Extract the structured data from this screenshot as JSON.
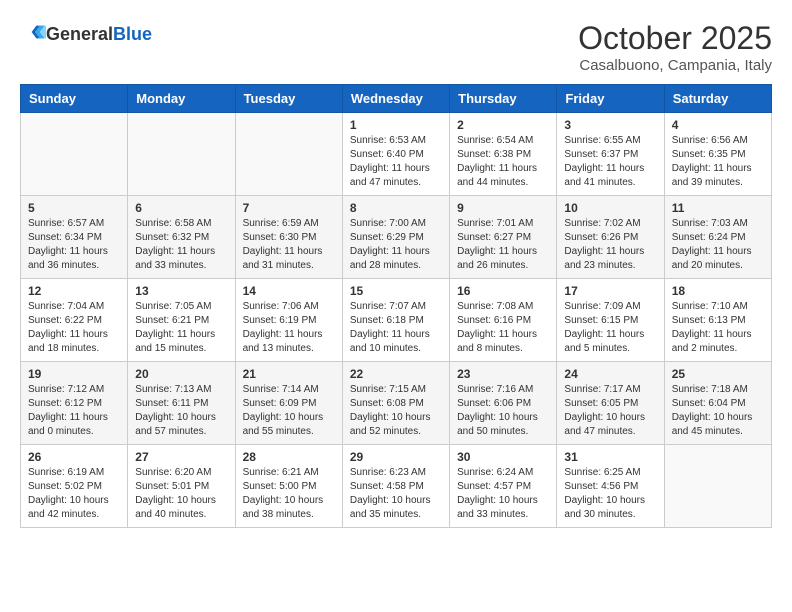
{
  "header": {
    "logo": {
      "general": "General",
      "blue": "Blue"
    },
    "month": "October 2025",
    "location": "Casalbuono, Campania, Italy"
  },
  "days_of_week": [
    "Sunday",
    "Monday",
    "Tuesday",
    "Wednesday",
    "Thursday",
    "Friday",
    "Saturday"
  ],
  "weeks": [
    [
      {
        "day": "",
        "info": ""
      },
      {
        "day": "",
        "info": ""
      },
      {
        "day": "",
        "info": ""
      },
      {
        "day": "1",
        "info": "Sunrise: 6:53 AM\nSunset: 6:40 PM\nDaylight: 11 hours and 47 minutes."
      },
      {
        "day": "2",
        "info": "Sunrise: 6:54 AM\nSunset: 6:38 PM\nDaylight: 11 hours and 44 minutes."
      },
      {
        "day": "3",
        "info": "Sunrise: 6:55 AM\nSunset: 6:37 PM\nDaylight: 11 hours and 41 minutes."
      },
      {
        "day": "4",
        "info": "Sunrise: 6:56 AM\nSunset: 6:35 PM\nDaylight: 11 hours and 39 minutes."
      }
    ],
    [
      {
        "day": "5",
        "info": "Sunrise: 6:57 AM\nSunset: 6:34 PM\nDaylight: 11 hours and 36 minutes."
      },
      {
        "day": "6",
        "info": "Sunrise: 6:58 AM\nSunset: 6:32 PM\nDaylight: 11 hours and 33 minutes."
      },
      {
        "day": "7",
        "info": "Sunrise: 6:59 AM\nSunset: 6:30 PM\nDaylight: 11 hours and 31 minutes."
      },
      {
        "day": "8",
        "info": "Sunrise: 7:00 AM\nSunset: 6:29 PM\nDaylight: 11 hours and 28 minutes."
      },
      {
        "day": "9",
        "info": "Sunrise: 7:01 AM\nSunset: 6:27 PM\nDaylight: 11 hours and 26 minutes."
      },
      {
        "day": "10",
        "info": "Sunrise: 7:02 AM\nSunset: 6:26 PM\nDaylight: 11 hours and 23 minutes."
      },
      {
        "day": "11",
        "info": "Sunrise: 7:03 AM\nSunset: 6:24 PM\nDaylight: 11 hours and 20 minutes."
      }
    ],
    [
      {
        "day": "12",
        "info": "Sunrise: 7:04 AM\nSunset: 6:22 PM\nDaylight: 11 hours and 18 minutes."
      },
      {
        "day": "13",
        "info": "Sunrise: 7:05 AM\nSunset: 6:21 PM\nDaylight: 11 hours and 15 minutes."
      },
      {
        "day": "14",
        "info": "Sunrise: 7:06 AM\nSunset: 6:19 PM\nDaylight: 11 hours and 13 minutes."
      },
      {
        "day": "15",
        "info": "Sunrise: 7:07 AM\nSunset: 6:18 PM\nDaylight: 11 hours and 10 minutes."
      },
      {
        "day": "16",
        "info": "Sunrise: 7:08 AM\nSunset: 6:16 PM\nDaylight: 11 hours and 8 minutes."
      },
      {
        "day": "17",
        "info": "Sunrise: 7:09 AM\nSunset: 6:15 PM\nDaylight: 11 hours and 5 minutes."
      },
      {
        "day": "18",
        "info": "Sunrise: 7:10 AM\nSunset: 6:13 PM\nDaylight: 11 hours and 2 minutes."
      }
    ],
    [
      {
        "day": "19",
        "info": "Sunrise: 7:12 AM\nSunset: 6:12 PM\nDaylight: 11 hours and 0 minutes."
      },
      {
        "day": "20",
        "info": "Sunrise: 7:13 AM\nSunset: 6:11 PM\nDaylight: 10 hours and 57 minutes."
      },
      {
        "day": "21",
        "info": "Sunrise: 7:14 AM\nSunset: 6:09 PM\nDaylight: 10 hours and 55 minutes."
      },
      {
        "day": "22",
        "info": "Sunrise: 7:15 AM\nSunset: 6:08 PM\nDaylight: 10 hours and 52 minutes."
      },
      {
        "day": "23",
        "info": "Sunrise: 7:16 AM\nSunset: 6:06 PM\nDaylight: 10 hours and 50 minutes."
      },
      {
        "day": "24",
        "info": "Sunrise: 7:17 AM\nSunset: 6:05 PM\nDaylight: 10 hours and 47 minutes."
      },
      {
        "day": "25",
        "info": "Sunrise: 7:18 AM\nSunset: 6:04 PM\nDaylight: 10 hours and 45 minutes."
      }
    ],
    [
      {
        "day": "26",
        "info": "Sunrise: 6:19 AM\nSunset: 5:02 PM\nDaylight: 10 hours and 42 minutes."
      },
      {
        "day": "27",
        "info": "Sunrise: 6:20 AM\nSunset: 5:01 PM\nDaylight: 10 hours and 40 minutes."
      },
      {
        "day": "28",
        "info": "Sunrise: 6:21 AM\nSunset: 5:00 PM\nDaylight: 10 hours and 38 minutes."
      },
      {
        "day": "29",
        "info": "Sunrise: 6:23 AM\nSunset: 4:58 PM\nDaylight: 10 hours and 35 minutes."
      },
      {
        "day": "30",
        "info": "Sunrise: 6:24 AM\nSunset: 4:57 PM\nDaylight: 10 hours and 33 minutes."
      },
      {
        "day": "31",
        "info": "Sunrise: 6:25 AM\nSunset: 4:56 PM\nDaylight: 10 hours and 30 minutes."
      },
      {
        "day": "",
        "info": ""
      }
    ]
  ]
}
